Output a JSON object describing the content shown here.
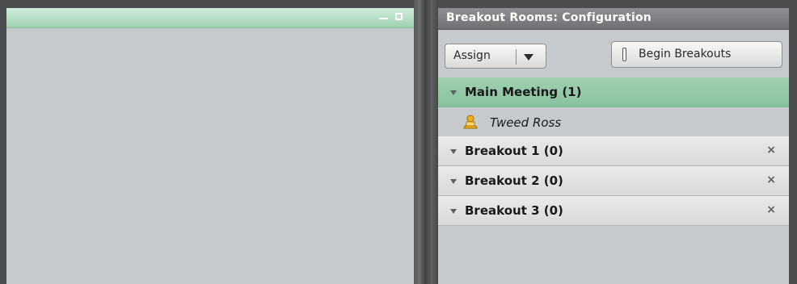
{
  "breakout_pod": {
    "title": "Breakout Rooms: Configuration",
    "toolbar": {
      "assign_label": "Assign",
      "begin_label": "Begin Breakouts"
    },
    "rooms": [
      {
        "title": "Main Meeting  (1)",
        "active": true,
        "participants": [
          "Tweed Ross"
        ]
      },
      {
        "title": "Breakout 1  (0)",
        "close": "×"
      },
      {
        "title": "Breakout 2  (0)",
        "close": "×"
      },
      {
        "title": "Breakout 3  (0)",
        "close": "×"
      }
    ]
  },
  "colors": {
    "active_room_header": "#9fd0b0",
    "pod_background": "#c7cacd",
    "title_bar": "#7e8083"
  },
  "icons": [
    "minimize-icon",
    "maximize-icon",
    "assign-dropdown-arrow-icon",
    "breakout-toggle-icon",
    "expand-triangle-icon",
    "user-icon",
    "close-icon"
  ]
}
